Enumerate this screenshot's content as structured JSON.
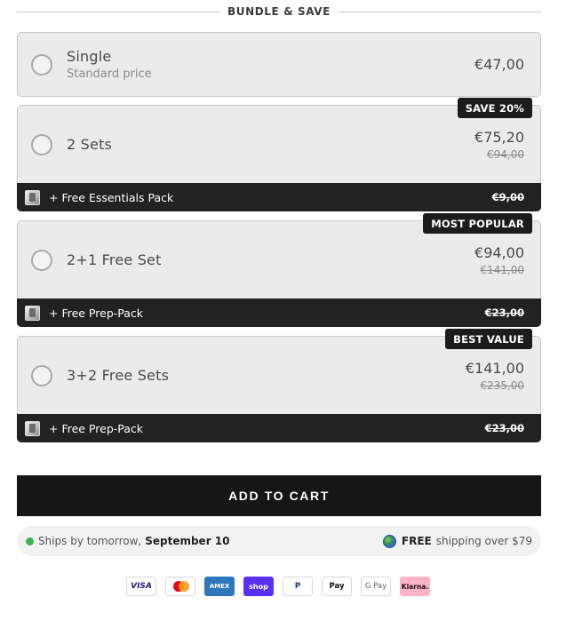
{
  "header": {
    "title": "BUNDLE & SAVE"
  },
  "options": [
    {
      "label": "Single",
      "sublabel": "Standard price",
      "price": "€47,00",
      "compare_price": "",
      "badge": "",
      "gift": null
    },
    {
      "label": "2 Sets",
      "sublabel": "",
      "price": "€75,20",
      "compare_price": "€94,00",
      "badge": "SAVE 20%",
      "gift": {
        "text": "+ Free Essentials Pack",
        "value": "€9,00"
      }
    },
    {
      "label": "2+1 Free Set",
      "sublabel": "",
      "price": "€94,00",
      "compare_price": "€141,00",
      "badge": "MOST POPULAR",
      "gift": {
        "text": "+ Free Prep-Pack",
        "value": "€23,00"
      }
    },
    {
      "label": "3+2 Free Sets",
      "sublabel": "",
      "price": "€141,00",
      "compare_price": "€235,00",
      "badge": "BEST VALUE",
      "gift": {
        "text": "+ Free Prep-Pack",
        "value": "€23,00"
      }
    }
  ],
  "cart": {
    "button_label": "ADD TO CART"
  },
  "shipping": {
    "left_text": "Ships by tomorrow,",
    "left_date": "September 10",
    "right_bold": "FREE",
    "right_text": "shipping over $79"
  },
  "payments": [
    "VISA",
    "Mastercard",
    "AMEX",
    "shop",
    "PayPal",
    "Apple Pay",
    "G Pay",
    "Klarna."
  ],
  "colors": {
    "dark": "#161616",
    "option_bg": "#ebebeb",
    "green_dot": "#3bb54a"
  }
}
